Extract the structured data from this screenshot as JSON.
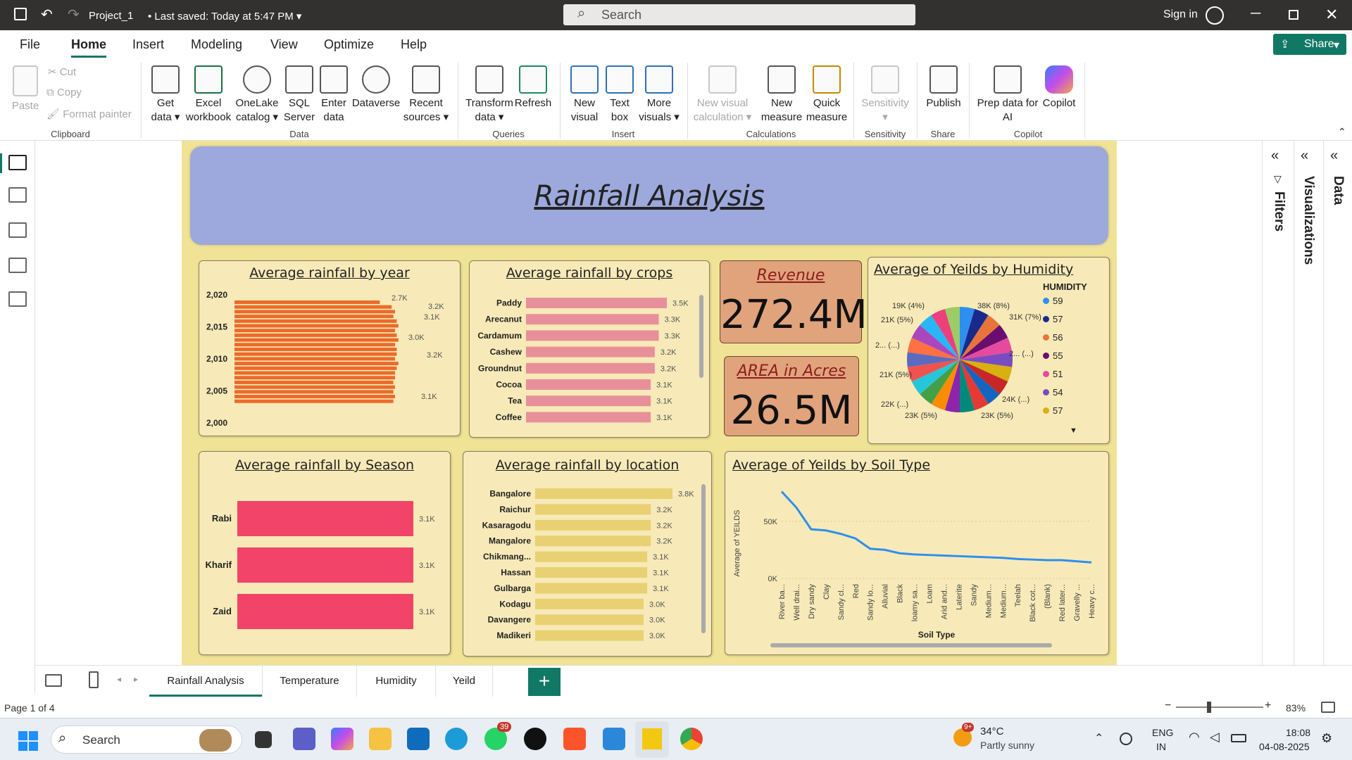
{
  "titlebar": {
    "file_name": "Project_1",
    "saved": "Last saved: Today at 5:47 PM",
    "search_placeholder": "Search",
    "signin": "Sign in"
  },
  "menu": [
    "File",
    "Home",
    "Insert",
    "Modeling",
    "View",
    "Optimize",
    "Help"
  ],
  "share_label": "Share",
  "ribbon": {
    "clipboard": {
      "paste": "Paste",
      "cut": "Cut",
      "copy": "Copy",
      "format_painter": "Format painter",
      "group": "Clipboard"
    },
    "data_items": [
      {
        "l1": "Get",
        "l2": "data ▾"
      },
      {
        "l1": "Excel",
        "l2": "workbook"
      },
      {
        "l1": "OneLake",
        "l2": "catalog ▾"
      },
      {
        "l1": "SQL",
        "l2": "Server"
      },
      {
        "l1": "Enter",
        "l2": "data"
      },
      {
        "l1": "Dataverse",
        "l2": ""
      },
      {
        "l1": "Recent",
        "l2": "sources ▾"
      }
    ],
    "data_group": "Data",
    "queries_items": [
      {
        "l1": "Transform",
        "l2": "data ▾"
      },
      {
        "l1": "Refresh",
        "l2": ""
      }
    ],
    "queries_group": "Queries",
    "insert_items": [
      {
        "l1": "New",
        "l2": "visual"
      },
      {
        "l1": "Text",
        "l2": "box"
      },
      {
        "l1": "More",
        "l2": "visuals ▾"
      }
    ],
    "insert_group": "Insert",
    "calc_items": [
      {
        "l1": "New visual",
        "l2": "calculation ▾"
      },
      {
        "l1": "New",
        "l2": "measure"
      },
      {
        "l1": "Quick",
        "l2": "measure"
      }
    ],
    "calc_group": "Calculations",
    "sensitivity": {
      "l1": "Sensitivity",
      "l2": "▾",
      "group": "Sensitivity"
    },
    "publish": {
      "l1": "Publish",
      "group": "Share"
    },
    "copilot_items": [
      {
        "l1": "Prep data for",
        "l2": "AI"
      },
      {
        "l1": "Copilot",
        "l2": ""
      }
    ],
    "copilot_group": "Copilot"
  },
  "report": {
    "banner_title": "Rainfall Analysis",
    "revenue": {
      "title": "Revenue",
      "value": "272.4M"
    },
    "area": {
      "title": "AREA in Acres",
      "value": "26.5M"
    }
  },
  "chart_data": [
    {
      "type": "bar",
      "title": "Average rainfall by year",
      "ytick_labels": [
        "2,020",
        "2,015",
        "2,010",
        "2,005",
        "2,000"
      ],
      "bar_count": 22,
      "data_labels": [
        "2.7K",
        "3.2K",
        "3.1K",
        "3.0K",
        "3.2K",
        "3.1K"
      ]
    },
    {
      "type": "bar",
      "title": "Average rainfall by crops",
      "categories": [
        "Paddy",
        "Arecanut",
        "Cardamum",
        "Cashew",
        "Groundnut",
        "Cocoa",
        "Tea",
        "Coffee"
      ],
      "values": [
        3500,
        3300,
        3300,
        3200,
        3200,
        3100,
        3100,
        3100
      ],
      "labels": [
        "3.5K",
        "3.3K",
        "3.3K",
        "3.2K",
        "3.2K",
        "3.1K",
        "3.1K",
        "3.1K"
      ],
      "color": "#e8909a"
    },
    {
      "type": "pie",
      "title": "Average of Yeilds by Humidity",
      "legend_title": "HUMIDITY",
      "legend": [
        {
          "name": "59",
          "color": "#2e8ff0"
        },
        {
          "name": "57",
          "color": "#1a2a8c"
        },
        {
          "name": "56",
          "color": "#e8743a"
        },
        {
          "name": "55",
          "color": "#6a0d70"
        },
        {
          "name": "51",
          "color": "#e64a9c"
        },
        {
          "name": "54",
          "color": "#7a4cc2"
        },
        {
          "name": "57",
          "color": "#d9b011"
        }
      ],
      "slice_labels": [
        "38K (8%)",
        "31K (7%)",
        "2... (...)",
        "24K (...)",
        "23K (5%)",
        "23K (5%)",
        "22K (...)",
        "21K (5%)",
        "2... (...)",
        "21K (5%)",
        "19K (4%)"
      ]
    },
    {
      "type": "bar",
      "title": "Average rainfall by Season",
      "categories": [
        "Rabi",
        "Kharif",
        "Zaid"
      ],
      "values": [
        3100,
        3100,
        3100
      ],
      "labels": [
        "3.1K",
        "3.1K",
        "3.1K"
      ],
      "color": "#f24468"
    },
    {
      "type": "bar",
      "title": "Average rainfall by location",
      "categories": [
        "Bangalore",
        "Raichur",
        "Kasaragodu",
        "Mangalore",
        "Chikmang...",
        "Hassan",
        "Gulbarga",
        "Kodagu",
        "Davangere",
        "Madikeri"
      ],
      "values": [
        3800,
        3200,
        3200,
        3200,
        3100,
        3100,
        3100,
        3000,
        3000,
        3000
      ],
      "labels": [
        "3.8K",
        "3.2K",
        "3.2K",
        "3.2K",
        "3.1K",
        "3.1K",
        "3.1K",
        "3.0K",
        "3.0K",
        "3.0K"
      ],
      "color": "#e9d072"
    },
    {
      "type": "line",
      "title": "Average of Yeilds by Soil Type",
      "xlabel": "Soil Type",
      "ylabel": "Average of YEILDS",
      "yticks": [
        "0K",
        "50K"
      ],
      "ylim": [
        0,
        80000
      ],
      "categories": [
        "River ba...",
        "Well drai...",
        "Dry sandy",
        "Clay",
        "Sandy cl...",
        "Red",
        "Sandy lo...",
        "Alluvial",
        "Black",
        "loamy sa...",
        "Loam",
        "Arid and...",
        "Laterite",
        "Sandy",
        "Medium...",
        "Medium...",
        "Teelah",
        "Black cot...",
        "(Blank)",
        "Red later...",
        "Gravelly ...",
        "Heavy c..."
      ],
      "values": [
        76000,
        62000,
        43000,
        42000,
        39000,
        35000,
        26000,
        25000,
        22000,
        21000,
        20500,
        20000,
        19500,
        19000,
        18500,
        18000,
        17000,
        16500,
        16000,
        16000,
        15000,
        14000
      ],
      "color": "#2e8ff0"
    }
  ],
  "pages": [
    "Rainfall Analysis",
    "Temperature",
    "Humidity",
    "Yeild"
  ],
  "side_panes": {
    "filters": "Filters",
    "visualizations": "Visualizations",
    "data": "Data"
  },
  "status": {
    "page": "Page 1 of 4",
    "zoom": "83%"
  },
  "taskbar": {
    "search": "Search",
    "weather_temp": "34°C",
    "weather_desc": "Partly sunny",
    "lang1": "ENG",
    "lang2": "IN",
    "time": "18:08",
    "date": "04-08-2025",
    "whatsapp_badge": "39",
    "weather_badge": "9+"
  }
}
